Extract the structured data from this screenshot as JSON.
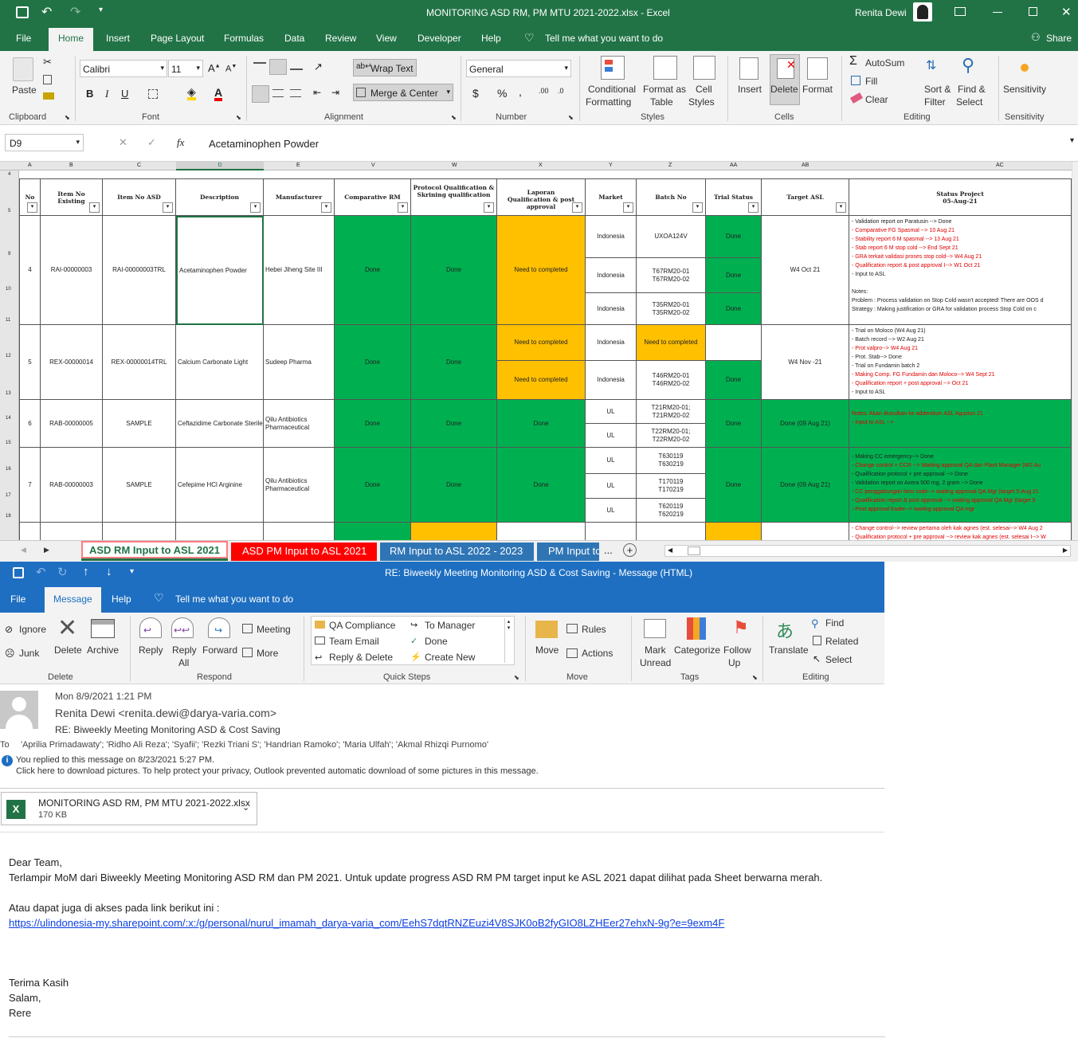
{
  "excel": {
    "window_title": "MONITORING ASD RM, PM MTU 2021-2022.xlsx  -  Excel",
    "user_name": "Renita Dewi",
    "menu": [
      "File",
      "Home",
      "Insert",
      "Page Layout",
      "Formulas",
      "Data",
      "Review",
      "View",
      "Developer",
      "Help"
    ],
    "tell_me": "Tell me what you want to do",
    "share": "Share",
    "ribbon": {
      "paste": "Paste",
      "clipboard": "Clipboard",
      "font_name": "Calibri",
      "font_size": "11",
      "font": "Font",
      "wrap_text": "Wrap Text",
      "merge_center": "Merge & Center",
      "alignment": "Alignment",
      "number_format": "General",
      "number": "Number",
      "conditional": "Conditional",
      "formatting": "Formatting",
      "format_as": "Format as",
      "table": "Table",
      "cell": "Cell",
      "styles_btn": "Styles",
      "styles": "Styles",
      "insert": "Insert",
      "delete": "Delete",
      "format": "Format",
      "cells": "Cells",
      "autosum": "AutoSum",
      "fill": "Fill",
      "clear": "Clear",
      "sort": "Sort &",
      "filter": "Filter",
      "find": "Find &",
      "select": "Select",
      "editing": "Editing",
      "sensitivity": "Sensitivity"
    },
    "name_box": "D9",
    "formula": "Acetaminophen Powder",
    "columns": [
      "A",
      "B",
      "C",
      "D",
      "E",
      "V",
      "W",
      "X",
      "Y",
      "Z",
      "AA",
      "AB",
      "AC"
    ],
    "headers": [
      "No",
      "Item No Existing",
      "Item No ASD",
      "Description",
      "Manufacturer",
      "Comparative RM",
      "Protocol Qualification & Skrining qualification",
      "Laporan Qualification & post approval",
      "Market",
      "Batch No",
      "Trial Status",
      "Target ASL",
      "Status Project 05-Aug-21"
    ],
    "row_numbers": [
      "4",
      "5",
      "9",
      "10",
      "11",
      "12",
      "13",
      "14",
      "15",
      "16",
      "17",
      "18"
    ],
    "rows": [
      {
        "no": "4",
        "existing": "RAI-00000003",
        "asd": "RAI-00000003TRL",
        "desc": "Acetaminophen Powder",
        "mfr": "Hebei Jiheng Site III",
        "comp": "Done",
        "prot": "Done",
        "lap": "Need to completed",
        "markets": [
          "Indonesia",
          "Indonesia",
          "Indonesia"
        ],
        "batches": [
          "UXOA124V",
          "T67RM20-01\nT67RM20-02",
          "T35RM20-01\nT35RM20-02"
        ],
        "trials": [
          "Done",
          "Done",
          "Done"
        ],
        "target": "W4 Oct 21",
        "status": [
          {
            "t": "- Validation report on Paratusin --> Done",
            "r": false
          },
          {
            "t": "- Comparative FG Spasmal --> 10 Aug 21",
            "r": true
          },
          {
            "t": "- Stability report 6 M spasmal --> 13 Aug 21",
            "r": true
          },
          {
            "t": "- Stab report 6 M stop cold --> End Sept 21",
            "r": true
          },
          {
            "t": "- GRA terkait validasi proses stop cold-->  W4 Aug 21",
            "r": true
          },
          {
            "t": "- Qualification report & post approval I--> W1 Oct 21",
            "r": true
          },
          {
            "t": "- Input to ASL",
            "r": false
          },
          {
            "t": "",
            "r": false
          },
          {
            "t": "Notes:",
            "r": false
          },
          {
            "t": "Problem : Process validation on Stop Cold wasn't accepted! There are OOS d",
            "r": false
          },
          {
            "t": "Strategy : Making justification or GRA for validation process Stop Cold on c",
            "r": false
          }
        ]
      },
      {
        "no": "5",
        "existing": "REX-00000014",
        "asd": "REX-00000014TRL",
        "desc": "Calcium Carbonate Light",
        "mfr": "Sudeep Pharma",
        "comp": "Done",
        "prot": "Done",
        "lap1": "Need to completed",
        "lap2": "Need to completed",
        "markets": [
          "Indonesia",
          "Indonesia"
        ],
        "batches": [
          "Need to completed",
          "T46RM20-01\nT46RM20-02"
        ],
        "trials": [
          "",
          "Done"
        ],
        "target": "W4 Nov -21",
        "status": [
          {
            "t": "- Trial on Moloco (W4 Aug 21)",
            "r": false
          },
          {
            "t": "- Batch record --> W2 Aug 21",
            "r": false
          },
          {
            "t": "- Prot valpro--> W4 Aug 21",
            "r": true
          },
          {
            "t": "- Prot. Stab--> Done",
            "r": false
          },
          {
            "t": "- Trial on Fundamin batch 2",
            "r": false
          },
          {
            "t": "- Making Comp. FG Fundamin dan Moloco--> W4 Sept 21",
            "r": true
          },
          {
            "t": "-  Qualification report + post approval --> Oct 21",
            "r": true
          },
          {
            "t": "- Input to ASL",
            "r": false
          }
        ]
      },
      {
        "no": "6",
        "existing": "RAB-00000005",
        "asd": "SAMPLE",
        "desc": "Ceftazidime Carbonate Sterile",
        "mfr": "Qilu Antibiotics Pharmaceutical",
        "comp": "Done",
        "prot": "Done",
        "lap": "Done",
        "markets": [
          "UL",
          "UL"
        ],
        "batches": [
          "T21RM20-01;\nT21RM20-02",
          "T22RM20-01;\nT22RM20-02"
        ],
        "trial": "Done",
        "target": "Done (09 Aug 21)",
        "status": [
          {
            "t": "Notes: Akan diusulkan ke addendum ASL Agustus 21",
            "r": true
          },
          {
            "t": "- Input to ASL -->",
            "r": true
          }
        ]
      },
      {
        "no": "7",
        "existing": "RAB-00000003",
        "asd": "SAMPLE",
        "desc": "Cefepime HCl Arginine",
        "mfr": "Qilu Antibiotics Pharmaceutical",
        "comp": "Done",
        "prot": "Done",
        "lap": "Done",
        "markets": [
          "UL",
          "UL",
          "UL"
        ],
        "batches": [
          "T630119\nT630219",
          "T170119\nT170219",
          "T620119\nT620219"
        ],
        "trial": "Done",
        "target": "Done (09 Aug 21)",
        "status": [
          {
            "t": "- Making CC emergency-->  Done",
            "r": false
          },
          {
            "t": "- Change control + CCR --> Waiting approval QA  dan Plant Manager (W2 Au",
            "r": true
          },
          {
            "t": "- Qualification protocol + pre approval --> Done",
            "r": false
          },
          {
            "t": "- Validation report on Axera 500 mg, 2 gram --> Done",
            "r": false
          },
          {
            "t": "- CC penggabungan item code--> waiting approval QA Mgr (target 5-Aug 21",
            "r": true
          },
          {
            "t": "- Qualification report & post approval --> waiting approval QA Mgr (target 5",
            "r": true
          },
          {
            "t": "- Post approval trader--> waiting approval QA mgr",
            "r": true
          }
        ]
      },
      {
        "status": [
          {
            "t": "- Change control--> review pertama oleh kak agnes (est. selesai-->  W4 Aug 2",
            "r": true
          },
          {
            "t": "- Qualification protocol + pre approval --> review kak agnes (est. selesai I--> W",
            "r": true
          }
        ]
      }
    ],
    "sheet_tabs": [
      "ASD RM Input to ASL 2021",
      "ASD PM Input to ASL 2021",
      "RM Input to ASL 2022 - 2023",
      "PM Input to"
    ],
    "sheet_more": "...",
    "colors": {
      "green": "#217346",
      "cell_green": "#00b050",
      "cell_yellow": "#ffc000",
      "tab_red": "#ff0000",
      "tab_blue": "#2f75b5"
    }
  },
  "outlook": {
    "window_title": "RE: Biweekly Meeting Monitoring ASD & Cost Saving  -  Message (HTML)",
    "menu": [
      "File",
      "Message",
      "Help"
    ],
    "tell_me": "Tell me what you want to do",
    "ribbon": {
      "ignore": "Ignore",
      "junk": "Junk",
      "delete": "Delete",
      "archive": "Archive",
      "delete_group": "Delete",
      "reply": "Reply",
      "reply_all_1": "Reply",
      "reply_all_2": "All",
      "forward": "Forward",
      "meeting": "Meeting",
      "more": "More",
      "respond": "Respond",
      "qs_1": "QA Compliance",
      "qs_2": "Team Email",
      "qs_3": "Reply & Delete",
      "qs_4": "To Manager",
      "qs_5": "Done",
      "qs_6": "Create New",
      "quick_steps": "Quick Steps",
      "move": "Move",
      "rules": "Rules",
      "actions": "Actions",
      "move_group": "Move",
      "mark": "Mark",
      "unread": "Unread",
      "categorize": "Categorize",
      "follow": "Follow",
      "up": "Up",
      "tags": "Tags",
      "translate": "Translate",
      "find": "Find",
      "related": "Related",
      "select": "Select",
      "editing": "Editing"
    },
    "date": "Mon 8/9/2021 1:21 PM",
    "from": "Renita Dewi <renita.dewi@darya-varia.com>",
    "subject": "RE: Biweekly Meeting Monitoring ASD & Cost Saving",
    "to_label": "To",
    "to": "'Aprilia Primadawaty'; 'Ridho Ali Reza'; 'Syafii'; 'Rezki Triani S'; 'Handrian Ramoko'; 'Maria Ulfah'; 'Akmal Rhizqi Purnomo'",
    "info1": "You replied to this message on 8/23/2021 5:27 PM.",
    "info2": "Click here to download pictures. To help protect your privacy, Outlook prevented automatic download of some pictures in this message.",
    "attachment_name": "MONITORING ASD RM, PM MTU 2021-2022.xlsx",
    "attachment_size": "170 KB",
    "body": {
      "greeting": "Dear Team,",
      "line1": "Terlampir MoM dari Biweekly Meeting Monitoring ASD RM dan PM 2021. Untuk update progress ASD RM PM target input ke ASL 2021 dapat dilihat pada Sheet berwarna merah.",
      "line2": "Atau dapat juga di akses pada link berikut ini :",
      "link": "https://ulindonesia-my.sharepoint.com/:x:/g/personal/nurul_imamah_darya-varia_com/EehS7dqtRNZEuzi4V8SJK0oB2fyGIO8LZHEer27ehxN-9g?e=9exm4F",
      "thanks": "Terima Kasih",
      "salam": "Salam,",
      "sign": "Rere"
    }
  }
}
